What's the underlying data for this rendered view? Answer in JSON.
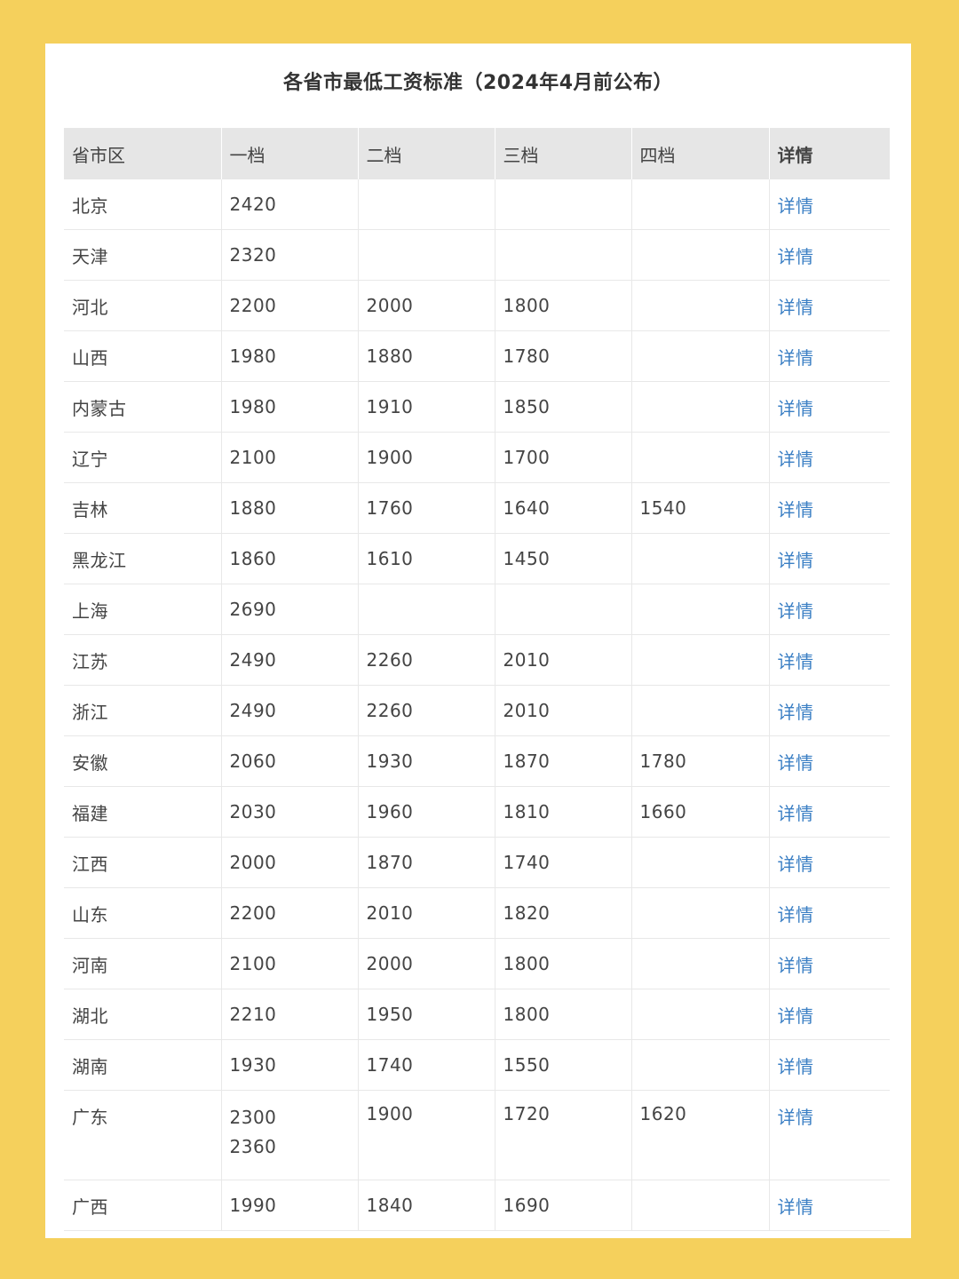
{
  "title": "各省市最低工资标准（2024年4月前公布）",
  "headers": [
    "省市区",
    "一档",
    "二档",
    "三档",
    "四档",
    "详情"
  ],
  "rows": [
    {
      "region": "北京",
      "t1": "2420",
      "t2": "",
      "t3": "",
      "t4": "",
      "detail": "详情"
    },
    {
      "region": "天津",
      "t1": "2320",
      "t2": "",
      "t3": "",
      "t4": "",
      "detail": "详情"
    },
    {
      "region": "河北",
      "t1": "2200",
      "t2": "2000",
      "t3": "1800",
      "t4": "",
      "detail": "详情"
    },
    {
      "region": "山西",
      "t1": "1980",
      "t2": "1880",
      "t3": "1780",
      "t4": "",
      "detail": "详情"
    },
    {
      "region": "内蒙古",
      "t1": "1980",
      "t2": "1910",
      "t3": "1850",
      "t4": "",
      "detail": "详情"
    },
    {
      "region": "辽宁",
      "t1": "2100",
      "t2": "1900",
      "t3": "1700",
      "t4": "",
      "detail": "详情"
    },
    {
      "region": "吉林",
      "t1": "1880",
      "t2": "1760",
      "t3": "1640",
      "t4": "1540",
      "detail": "详情"
    },
    {
      "region": "黑龙江",
      "t1": "1860",
      "t2": "1610",
      "t3": "1450",
      "t4": "",
      "detail": "详情"
    },
    {
      "region": "上海",
      "t1": "2690",
      "t2": "",
      "t3": "",
      "t4": "",
      "detail": "详情"
    },
    {
      "region": "江苏",
      "t1": "2490",
      "t2": "2260",
      "t3": "2010",
      "t4": "",
      "detail": "详情"
    },
    {
      "region": "浙江",
      "t1": "2490",
      "t2": "2260",
      "t3": "2010",
      "t4": "",
      "detail": "详情"
    },
    {
      "region": "安徽",
      "t1": "2060",
      "t2": "1930",
      "t3": "1870",
      "t4": "1780",
      "detail": "详情"
    },
    {
      "region": "福建",
      "t1": "2030",
      "t2": "1960",
      "t3": "1810",
      "t4": "1660",
      "detail": "详情"
    },
    {
      "region": "江西",
      "t1": "2000",
      "t2": "1870",
      "t3": "1740",
      "t4": "",
      "detail": "详情"
    },
    {
      "region": "山东",
      "t1": "2200",
      "t2": "2010",
      "t3": "1820",
      "t4": "",
      "detail": "详情"
    },
    {
      "region": "河南",
      "t1": "2100",
      "t2": "2000",
      "t3": "1800",
      "t4": "",
      "detail": "详情"
    },
    {
      "region": "湖北",
      "t1": "2210",
      "t2": "1950",
      "t3": "1800",
      "t4": "",
      "detail": "详情"
    },
    {
      "region": "湖南",
      "t1": "1930",
      "t2": "1740",
      "t3": "1550",
      "t4": "",
      "detail": "详情"
    },
    {
      "region": "广东",
      "t1": "2300",
      "t1b": "2360",
      "t2": "1900",
      "t3": "1720",
      "t4": "1620",
      "detail": "详情"
    },
    {
      "region": "广西",
      "t1": "1990",
      "t2": "1840",
      "t3": "1690",
      "t4": "",
      "detail": "详情"
    }
  ]
}
